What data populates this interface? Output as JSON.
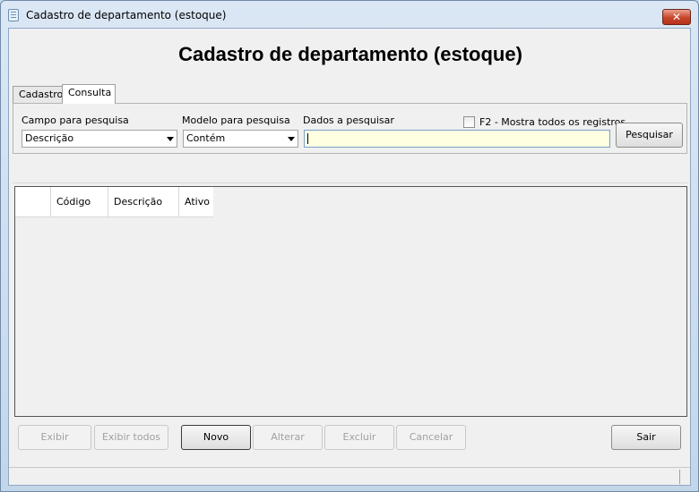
{
  "window": {
    "title": "Cadastro de departamento (estoque)",
    "close_label": "✕"
  },
  "header": {
    "title": "Cadastro de departamento (estoque)"
  },
  "tabs": [
    {
      "label": "Cadastro"
    },
    {
      "label": "Consulta"
    }
  ],
  "search": {
    "field_label": "Campo para pesquisa",
    "field_value": "Descrição",
    "model_label": "Modelo para pesquisa",
    "model_value": "Contém",
    "data_label": "Dados a pesquisar",
    "data_value": "",
    "show_all_label": "F2 - Mostra todos os registros",
    "show_all_checked": false,
    "search_button": "Pesquisar"
  },
  "grid": {
    "columns": [
      "",
      "Código",
      "Descrição",
      "Ativo"
    ],
    "rows": []
  },
  "actions": {
    "exibir": "Exibir",
    "exibir_todos": "Exibir todos",
    "novo": "Novo",
    "alterar": "Alterar",
    "excluir": "Excluir",
    "cancelar": "Cancelar",
    "sair": "Sair"
  },
  "colors": {
    "titlebar": "#c3d6ea",
    "input_bg": "#ffffe1",
    "close_button": "#c7452b"
  }
}
